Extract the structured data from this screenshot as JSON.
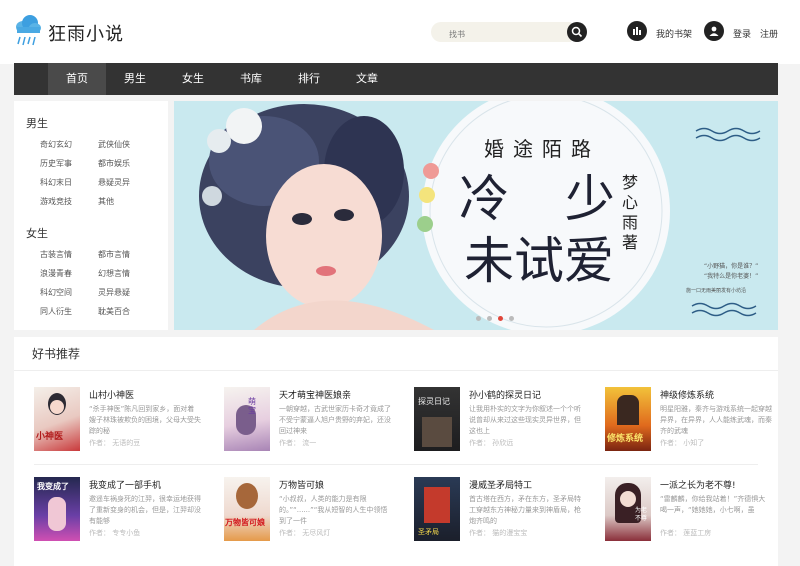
{
  "header": {
    "logo": "狂雨小说",
    "search_placeholder": "找书",
    "shelf_label": "我的书架",
    "login_label": "登录",
    "register_label": "注册"
  },
  "nav": [
    "首页",
    "男生",
    "女生",
    "书库",
    "排行",
    "文章"
  ],
  "sidebar": {
    "male": {
      "title": "男生",
      "links": [
        "奇幻玄幻",
        "武侠仙侠",
        "历史军事",
        "都市娱乐",
        "科幻末日",
        "悬疑灵异",
        "游戏竞技",
        "其他"
      ]
    },
    "female": {
      "title": "女生",
      "links": [
        "古装言情",
        "都市言情",
        "浪漫青春",
        "幻想言情",
        "科幻空间",
        "灵异悬疑",
        "同人衍生",
        "耽美百合"
      ]
    }
  },
  "banner": {
    "subtitle": "婚途陌路",
    "title_line1": "冷 少",
    "title_line2": "未试爱",
    "author": "梦心雨著",
    "quote_line1": "“小野猫，你是谁？”",
    "quote_line2": "“我特么是你老婆！”",
    "note": "施一口无雨美丽发有小坊沿"
  },
  "recommend": {
    "title": "好书推荐",
    "books": [
      {
        "title": "山村小神医",
        "desc": "“杀手神医”陈凡回到家乡，面对着嫂子林珠被欺负的困境，父母大受失踪的秘",
        "author": "作者： 无语的豆",
        "cover_text": "小神医"
      },
      {
        "title": "天才萌宝神医娘亲",
        "desc": "一朝穿越，古武世家历卡奇才竟成了不受宁蒙逼人旭户贵野的弃妃，还没回过神来",
        "author": "作者： 流一",
        "cover_text": "萌宝"
      },
      {
        "title": "孙小鹤的探灵日记",
        "desc": "让我用朴实的文字为你叙述一个个听说曾却从来过这些现实灵异世界，但这也上",
        "author": "作者： 孙欣远",
        "cover_text": "探灵日记"
      },
      {
        "title": "神级修炼系统",
        "desc": "明星阳雅，秦齐与游戏系统一起穿越异界，在异界，人人能练武魂，而秦齐的武魂",
        "author": "作者： 小知了",
        "cover_text": "修炼系统"
      },
      {
        "title": "我变成了一部手机",
        "desc": "邀遥车祸身死的江羿，很幸运地获得了重新变身的机会，但是，江羿却没有能够",
        "author": "作者： 专专小鱼",
        "cover_text": "我变成了"
      },
      {
        "title": "万物皆可娘",
        "desc": "“小叔叔，人类的能力是有限的。”“......”“我从短智的人生中领悟到了一件",
        "author": "作者： 无尽风灯",
        "cover_text": "万物皆可娘"
      },
      {
        "title": "漫威圣矛局特工",
        "desc": "首古塔在西方，矛在东方，圣矛局特工穿越东方神秘力量来到神盾局，枪炮齐鸣的",
        "author": "作者： 猫的漫宝宝",
        "cover_text": "圣矛局"
      },
      {
        "title": "一派之长为老不尊!",
        "desc": "“雷麟麟，你给我站着！”齐德惧大喝一声，“她她她，小七啊，虽",
        "author": "作者： 莲蓝工房",
        "cover_text": "为老不尊"
      }
    ]
  }
}
